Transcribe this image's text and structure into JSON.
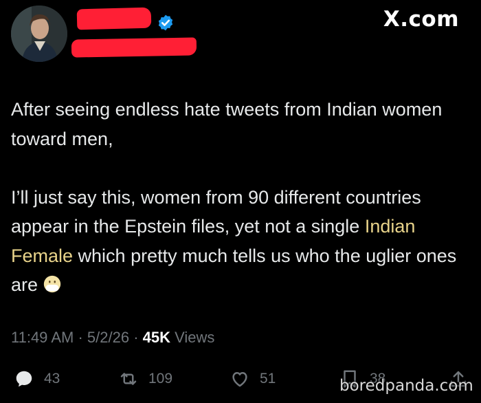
{
  "header": {
    "brand": "X.com"
  },
  "tweet": {
    "paragraph1": "After seeing endless hate tweets from Indian women toward men,",
    "paragraph2_before": "I’ll just say this, women from 90 different countries appear in the Epstein files, yet not a single ",
    "paragraph2_highlight": "Indian Female",
    "paragraph2_after": " which pretty much tells us who the uglier ones are",
    "emoji": "mouth-covered-face-icon",
    "highlight_color": "#e8d38a"
  },
  "meta": {
    "time": "11:49 AM",
    "separator": "·",
    "date": "5/2/26",
    "views_count": "45K",
    "views_label": "Views"
  },
  "actions": {
    "replies": "43",
    "reposts": "109",
    "likes": "51",
    "bookmarks": "38"
  },
  "watermark": "boredpanda.com",
  "colors": {
    "background": "#000000",
    "text": "#e7e9ea",
    "muted": "#71767b",
    "verified": "#1d9bf0",
    "redaction": "#ff1f35"
  }
}
